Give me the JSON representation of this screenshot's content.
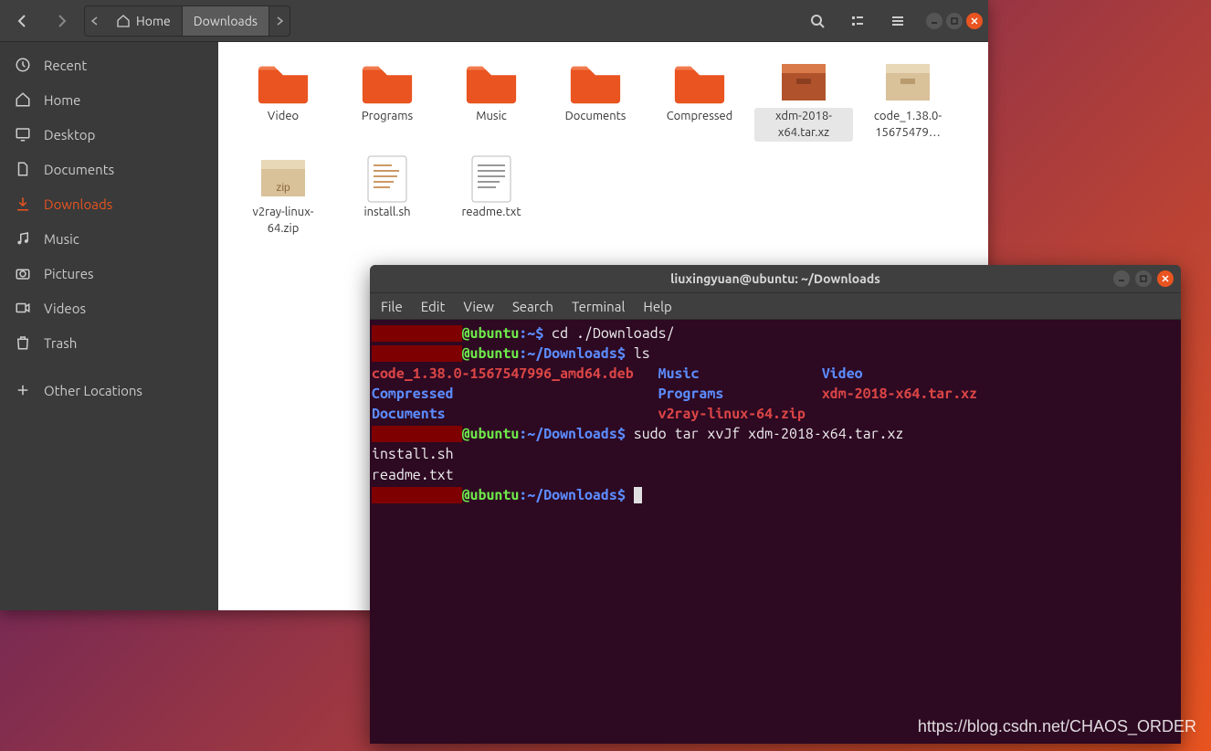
{
  "nautilus": {
    "path": {
      "home": "Home",
      "current": "Downloads"
    },
    "sidebar": {
      "recent": "Recent",
      "home": "Home",
      "desktop": "Desktop",
      "documents": "Documents",
      "downloads": "Downloads",
      "music": "Music",
      "pictures": "Pictures",
      "videos": "Videos",
      "trash": "Trash",
      "other": "Other Locations"
    },
    "files": {
      "f0": "Video",
      "f1": "Programs",
      "f2": "Music",
      "f3": "Documents",
      "f4": "Compressed",
      "f5": "xdm-2018-x64.tar.xz",
      "f6": "code_1.38.0-15675479…",
      "f7": "v2ray-linux-64.zip",
      "f8": "install.sh",
      "f9": "readme.txt"
    }
  },
  "terminal": {
    "title": "liuxingyuan@ubuntu: ~/Downloads",
    "menu": {
      "file": "File",
      "edit": "Edit",
      "view": "View",
      "search": "Search",
      "terminal": "Terminal",
      "help": "Help"
    },
    "l1_userhost": "@ubuntu",
    "l1_path": ":~$",
    "l1_cmd": " cd ./Downloads/",
    "l2_path": ":~/Downloads$",
    "l2_cmd": " ls",
    "ls_deb": "code_1.38.0-1567547996_amd64.deb",
    "ls_music": "Music",
    "ls_video": "Video",
    "ls_comp": "Compressed",
    "ls_prog": "Programs",
    "ls_xdm": "xdm-2018-x64.tar.xz",
    "ls_docs": "Documents",
    "ls_zip": "v2ray-linux-64.zip",
    "l3_cmd": " sudo tar xvJf xdm-2018-x64.tar.xz",
    "out1": "install.sh",
    "out2": "readme.txt",
    "blank_host": "           "
  },
  "watermark": "https://blog.csdn.net/CHAOS_ORDER"
}
